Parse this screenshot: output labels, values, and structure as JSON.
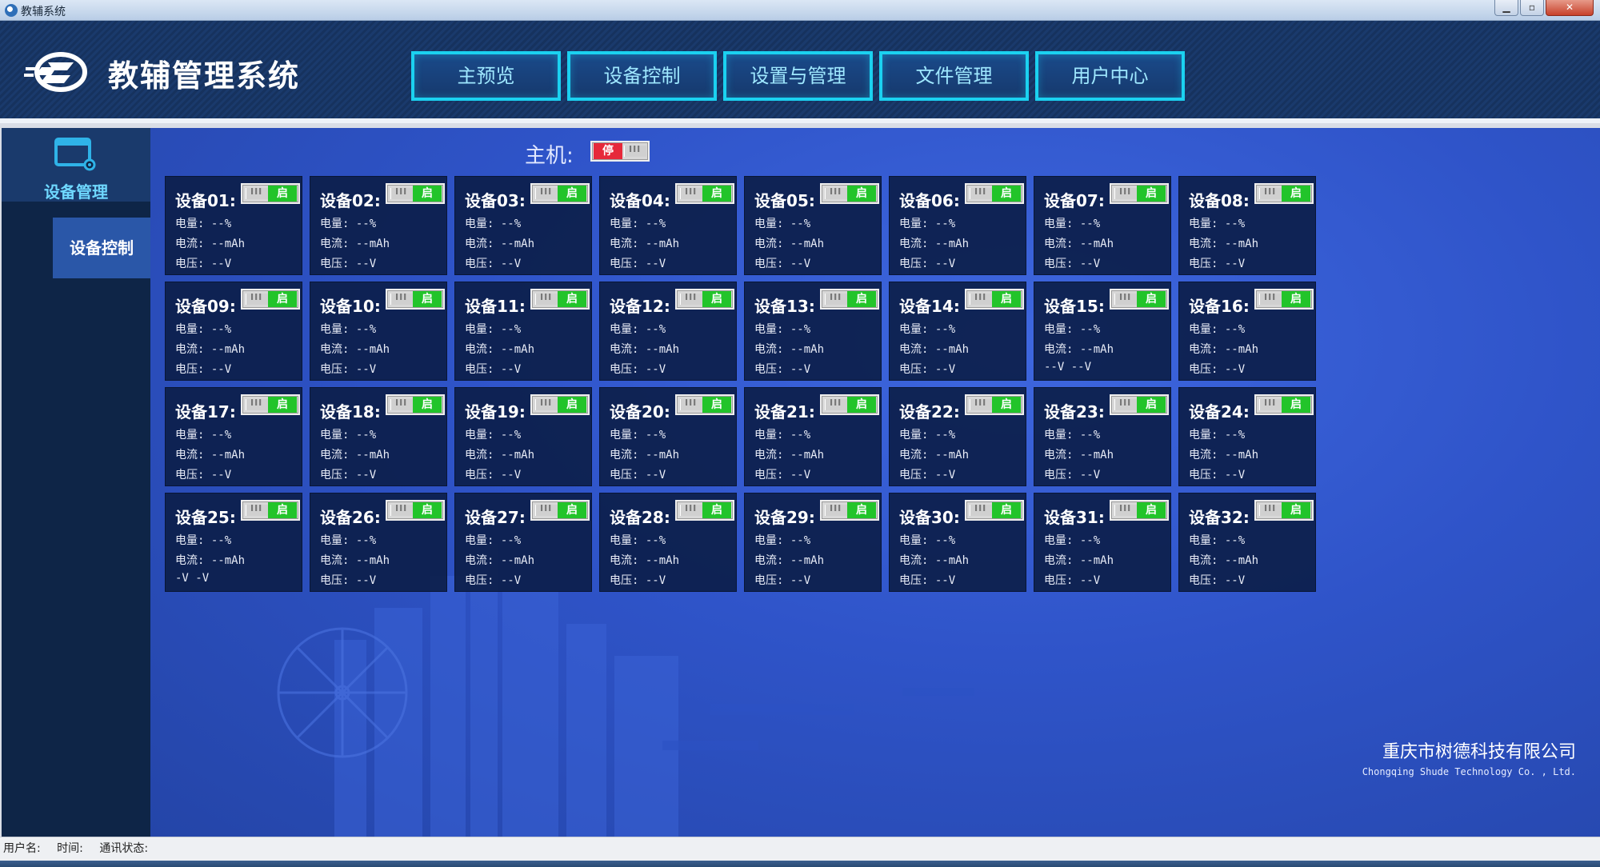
{
  "window": {
    "title": "教辅系统",
    "min_icon": "minimize-icon",
    "max_icon": "maximize-icon",
    "close_icon": "close-icon"
  },
  "header": {
    "title": "教辅管理系统",
    "logo_icon": "brand-logo-icon",
    "nav": [
      "主预览",
      "设备控制",
      "设置与管理",
      "文件管理",
      "用户中心"
    ]
  },
  "sidebar": {
    "module_icon": "device-settings-icon",
    "module_label": "设备管理",
    "items": [
      {
        "label": "设备控制",
        "active": true
      }
    ]
  },
  "host": {
    "label": "主机:",
    "state_label": "停",
    "state": "off"
  },
  "device_toggle_label": "启",
  "devices": [
    {
      "name": "设备01:",
      "power": "电量: --%",
      "current": "电流: --mAh",
      "voltage": "电压: --V"
    },
    {
      "name": "设备02:",
      "power": "电量: --%",
      "current": "电流: --mAh",
      "voltage": "电压: --V"
    },
    {
      "name": "设备03:",
      "power": "电量: --%",
      "current": "电流: --mAh",
      "voltage": "电压: --V"
    },
    {
      "name": "设备04:",
      "power": "电量: --%",
      "current": "电流: --mAh",
      "voltage": "电压: --V"
    },
    {
      "name": "设备05:",
      "power": "电量: --%",
      "current": "电流: --mAh",
      "voltage": "电压: --V"
    },
    {
      "name": "设备06:",
      "power": "电量: --%",
      "current": "电流: --mAh",
      "voltage": "电压: --V"
    },
    {
      "name": "设备07:",
      "power": "电量: --%",
      "current": "电流: --mAh",
      "voltage": "电压: --V"
    },
    {
      "name": "设备08:",
      "power": "电量: --%",
      "current": "电流: --mAh",
      "voltage": "电压: --V"
    },
    {
      "name": "设备09:",
      "power": "电量: --%",
      "current": "电流: --mAh",
      "voltage": "电压: --V"
    },
    {
      "name": "设备10:",
      "power": "电量: --%",
      "current": "电流: --mAh",
      "voltage": "电压: --V"
    },
    {
      "name": "设备11:",
      "power": "电量: --%",
      "current": "电流: --mAh",
      "voltage": "电压: --V"
    },
    {
      "name": "设备12:",
      "power": "电量: --%",
      "current": "电流: --mAh",
      "voltage": "电压: --V"
    },
    {
      "name": "设备13:",
      "power": "电量: --%",
      "current": "电流: --mAh",
      "voltage": "电压: --V"
    },
    {
      "name": "设备14:",
      "power": "电量: --%",
      "current": "电流: --mAh",
      "voltage": "电压: --V"
    },
    {
      "name": "设备15:",
      "power": "电量: --%",
      "current": "电流: --mAh",
      "voltage": "--V --V"
    },
    {
      "name": "设备16:",
      "power": "电量: --%",
      "current": "电流: --mAh",
      "voltage": "电压: --V"
    },
    {
      "name": "设备17:",
      "power": "电量: --%",
      "current": "电流: --mAh",
      "voltage": "电压: --V"
    },
    {
      "name": "设备18:",
      "power": "电量: --%",
      "current": "电流: --mAh",
      "voltage": "电压: --V"
    },
    {
      "name": "设备19:",
      "power": "电量: --%",
      "current": "电流: --mAh",
      "voltage": "电压: --V"
    },
    {
      "name": "设备20:",
      "power": "电量: --%",
      "current": "电流: --mAh",
      "voltage": "电压: --V"
    },
    {
      "name": "设备21:",
      "power": "电量: --%",
      "current": "电流: --mAh",
      "voltage": "电压: --V"
    },
    {
      "name": "设备22:",
      "power": "电量: --%",
      "current": "电流: --mAh",
      "voltage": "电压: --V"
    },
    {
      "name": "设备23:",
      "power": "电量: --%",
      "current": "电流: --mAh",
      "voltage": "电压: --V"
    },
    {
      "name": "设备24:",
      "power": "电量: --%",
      "current": "电流: --mAh",
      "voltage": "电压: --V"
    },
    {
      "name": "设备25:",
      "power": "电量: --%",
      "current": "电流: --mAh",
      "voltage": "-V -V"
    },
    {
      "name": "设备26:",
      "power": "电量: --%",
      "current": "电流: --mAh",
      "voltage": "电压: --V"
    },
    {
      "name": "设备27:",
      "power": "电量: --%",
      "current": "电流: --mAh",
      "voltage": "电压: --V"
    },
    {
      "name": "设备28:",
      "power": "电量: --%",
      "current": "电流: --mAh",
      "voltage": "电压: --V"
    },
    {
      "name": "设备29:",
      "power": "电量: --%",
      "current": "电流: --mAh",
      "voltage": "电压: --V"
    },
    {
      "name": "设备30:",
      "power": "电量: --%",
      "current": "电流: --mAh",
      "voltage": "电压: --V"
    },
    {
      "name": "设备31:",
      "power": "电量: --%",
      "current": "电流: --mAh",
      "voltage": "电压: --V"
    },
    {
      "name": "设备32:",
      "power": "电量: --%",
      "current": "电流: --mAh",
      "voltage": "电压: --V"
    }
  ],
  "company": {
    "cn": "重庆市树德科技有限公司",
    "en": "Chongqing Shude Technology Co. , Ltd."
  },
  "statusbar": {
    "user_label": "用户名:",
    "time_label": "时间:",
    "comm_label": "通讯状态:"
  },
  "colors": {
    "accent_cyan": "#1bd1f0",
    "on_green": "#22c42a",
    "off_red": "#e6293a",
    "card_bg": "#0c1e4a",
    "main_blue": "#2f54c9"
  }
}
